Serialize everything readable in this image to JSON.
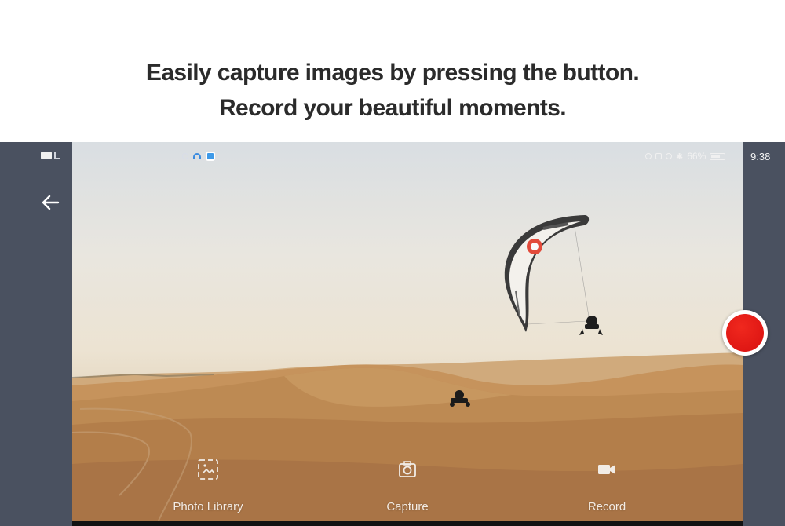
{
  "promo": {
    "headline_line1": "Easily capture images by pressing the button.",
    "headline_line2": "Record your beautiful moments."
  },
  "status_bar": {
    "left_badge_icon": "hd-signal-icon",
    "app_icons": [
      "app-notification-icon",
      "app-notification-icon",
      "app-notification-icon"
    ],
    "battery_percent": "66%",
    "time": "9:38"
  },
  "camera": {
    "back_icon": "arrow-left-icon",
    "record_button_color": "#e01a14",
    "actions": [
      {
        "label": "Photo Library",
        "icon": "photo-library-icon"
      },
      {
        "label": "Capture",
        "icon": "camera-icon"
      },
      {
        "label": "Record",
        "icon": "video-camera-icon"
      }
    ]
  },
  "colors": {
    "side_panel": "#4a5160",
    "headline_text": "#2b2b2b"
  }
}
